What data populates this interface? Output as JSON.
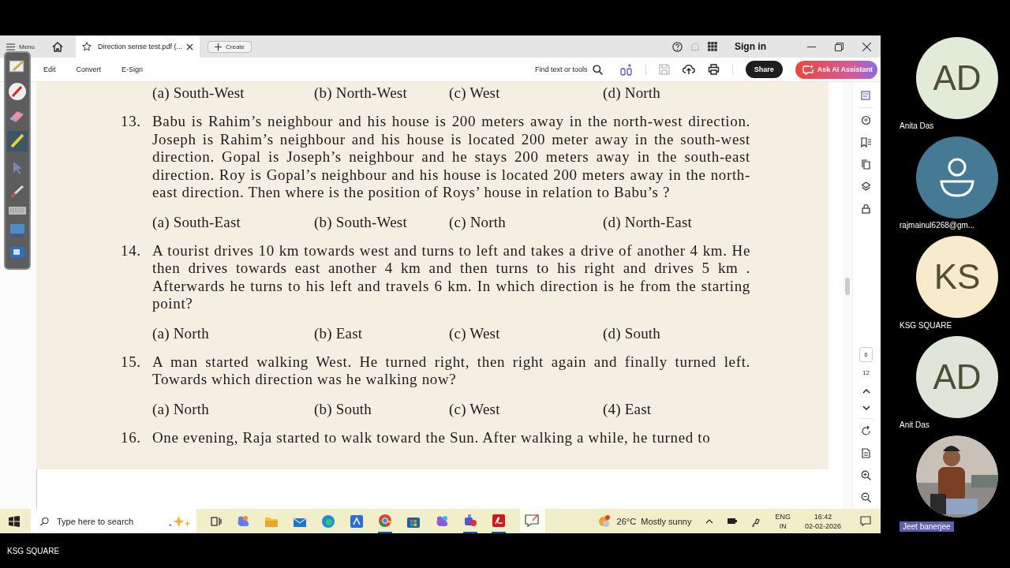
{
  "tab_bar": {
    "menu": "Menu",
    "tabs": [
      {
        "title": "Direction sense test.pdf (...",
        "selected": true
      }
    ],
    "create": "Create",
    "sign_in": "Sign in"
  },
  "toolbar": {
    "items": [
      "Edit",
      "Convert",
      "E-Sign"
    ],
    "search": "Find text or tools",
    "share": "Share",
    "assistant": "Ask AI Assistant"
  },
  "document": {
    "blocks": [
      {
        "kind": "options",
        "options": [
          "(a) South-West",
          "(b) North-West",
          "(c) West",
          "(d) North"
        ]
      },
      {
        "kind": "question",
        "number": "13.",
        "text": "Babu is Rahim’s neighbour and his house is 200 meters away in the north-west direction. Joseph is Rahim’s neighbour and his house is located 200 meter away in the south-west direction. Gopal is Joseph’s neighbour and he stays 200 meters away in the south-east direction. Roy is Gopal’s neighbour and his house is located 200 meters away in the north-east direction. Then where is the position of Roys’ house in relation to Babu’s ?"
      },
      {
        "kind": "options",
        "options": [
          "(a) South-East",
          "(b) South-West",
          "(c) North",
          "(d) North-East"
        ]
      },
      {
        "kind": "question",
        "number": "14.",
        "text": "A tourist drives 10 km towards west and turns to left and takes a drive of another 4 km. He then drives towards east another 4 km and then turns to his right and drives 5 km . Afterwards he turns to his left and travels 6 km.  In which direction is he from the starting point?"
      },
      {
        "kind": "options",
        "options": [
          "(a) North",
          "(b) East",
          "(c) West",
          "(d) South"
        ]
      },
      {
        "kind": "question",
        "number": "15.",
        "text": "A man started walking West. He turned right, then right again and finally turned left. Towards which direction was he walking now?"
      },
      {
        "kind": "options",
        "options": [
          "(a) North",
          "(b) South",
          "(c) West",
          "(4) East"
        ]
      },
      {
        "kind": "question",
        "number": "16.",
        "text": "One evening, Raja started to walk toward the Sun. After walking a while, he turned to"
      }
    ]
  },
  "page_nav": {
    "current": "6",
    "total": "12"
  },
  "taskbar": {
    "search_placeholder": "Type here to search",
    "weather": "26°C  Mostly sunny",
    "language": "ENG",
    "region": "IN",
    "time": "16:42",
    "date": "02-02-2026"
  },
  "participants": [
    {
      "kind": "initials",
      "initials": "AD",
      "name": "Anita Das",
      "color": "#e2ead8"
    },
    {
      "kind": "silhouette",
      "name": "rajmainul6268@gm...",
      "color": "#467a94"
    },
    {
      "kind": "initials",
      "initials": "KS",
      "name": "KSG SQUARE",
      "color": "#f8ebcb"
    },
    {
      "kind": "initials",
      "initials": "AD",
      "name": "Anit  Das",
      "color": "#dfe6d9"
    },
    {
      "kind": "picture",
      "name": "Jeet  banerjee"
    }
  ],
  "caption": "KSG SQUARE"
}
